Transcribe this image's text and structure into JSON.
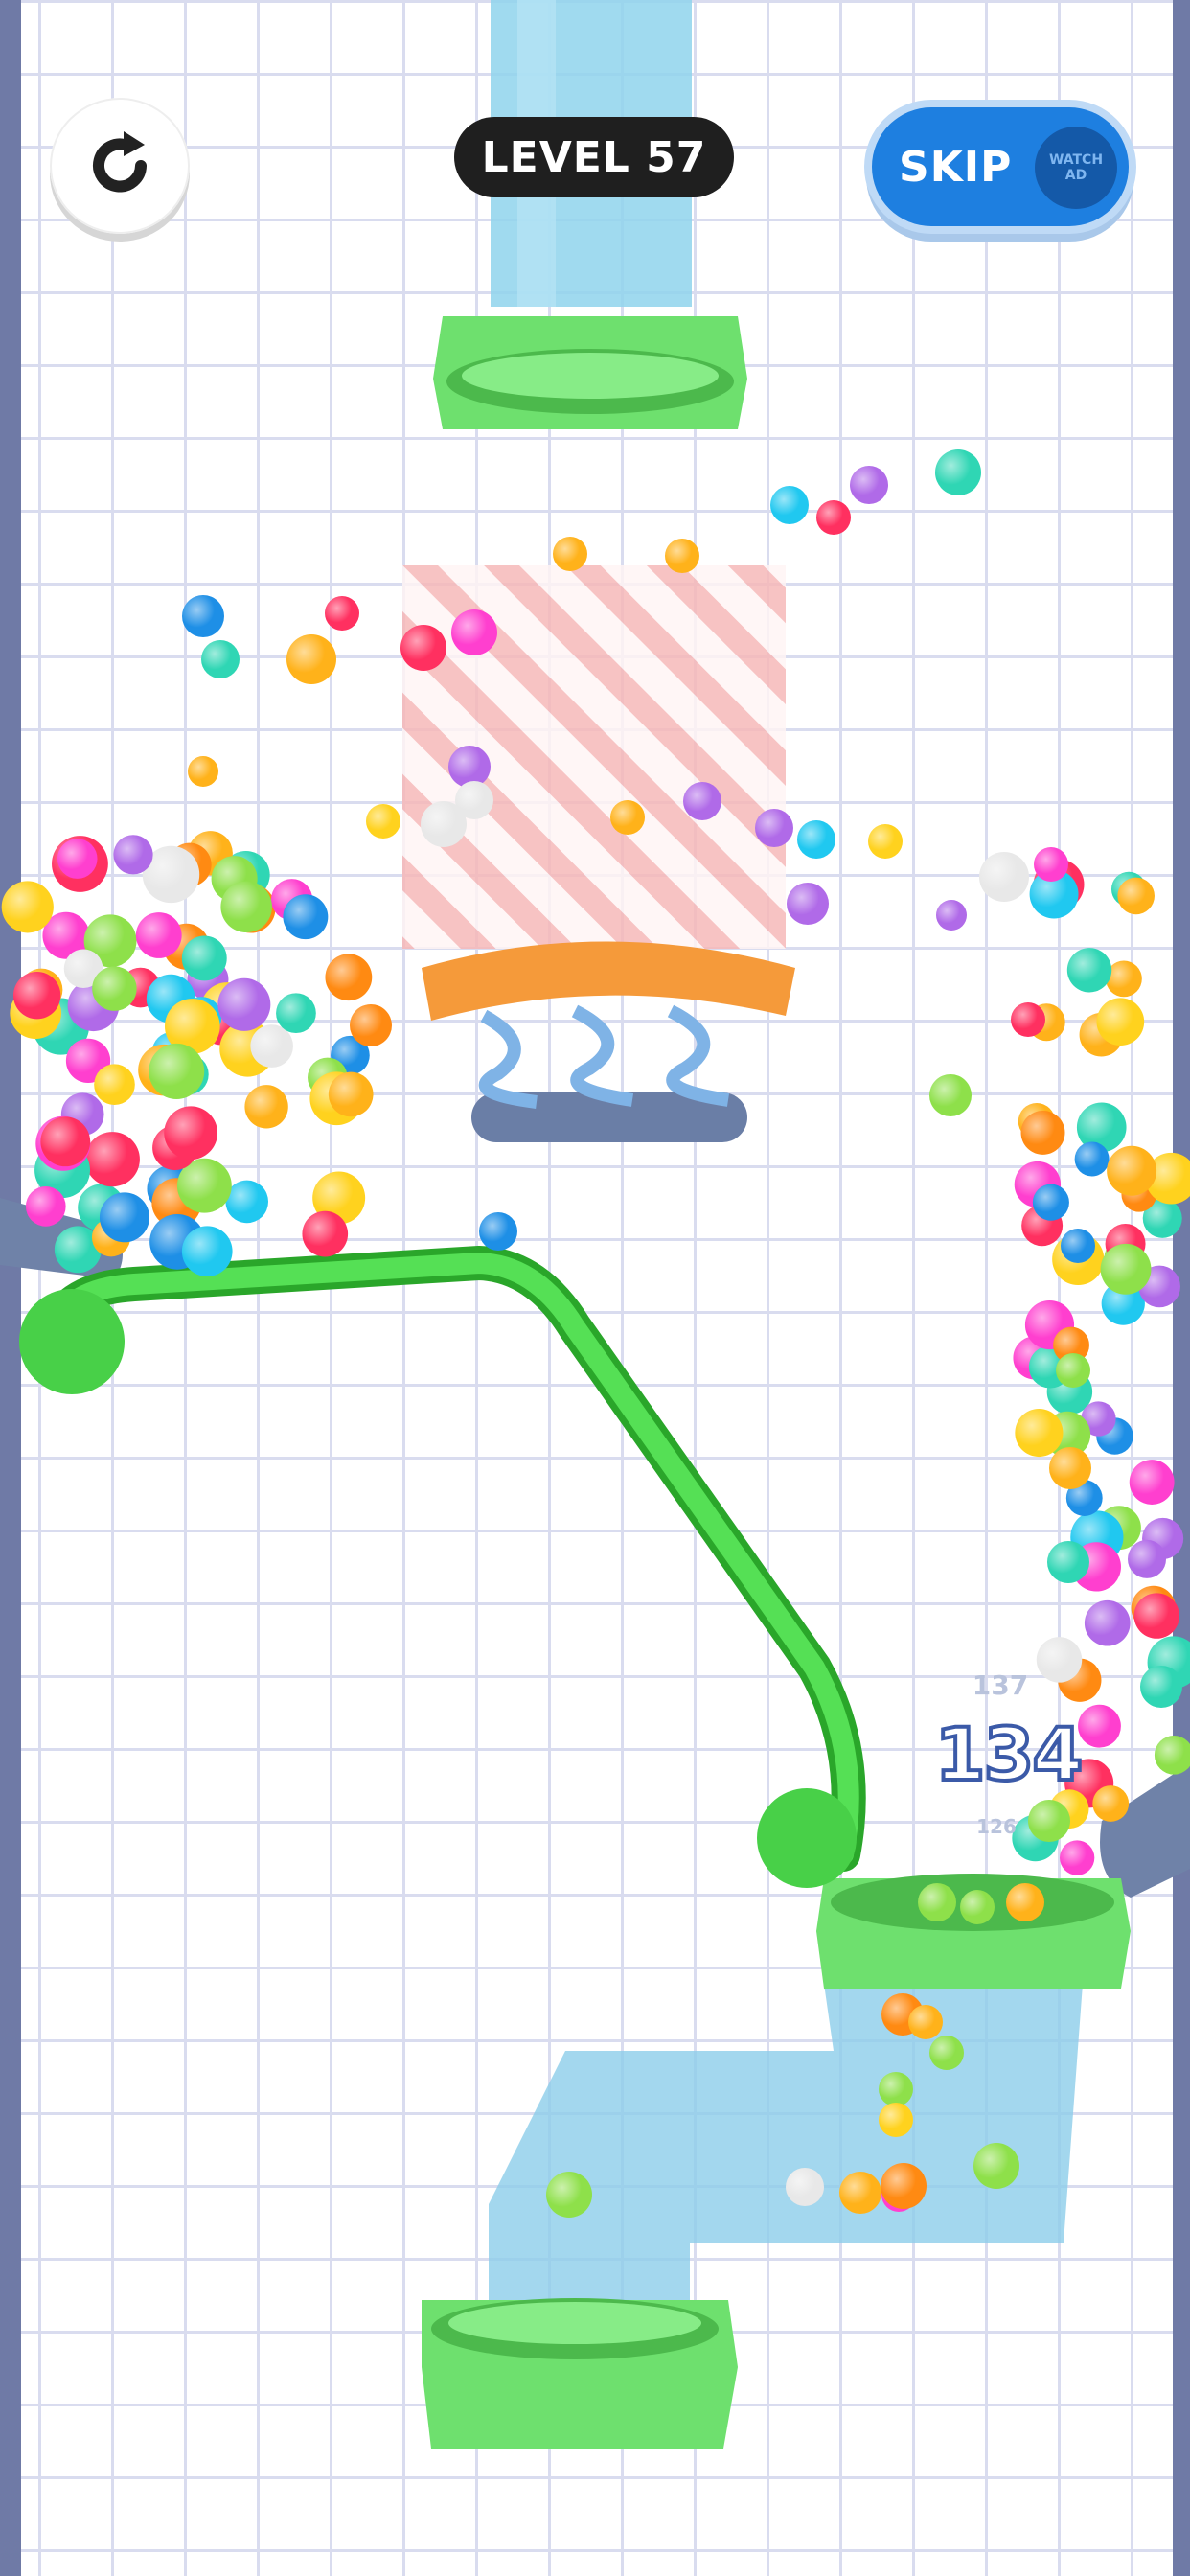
{
  "hud": {
    "level_label": "LEVEL 57",
    "skip_label": "SKIP",
    "watch_ad_line1": "WATCH",
    "watch_ad_line2": "AD"
  },
  "counter": {
    "current": "134",
    "previous": "137",
    "next": "126"
  },
  "icons": {
    "restart": "restart-icon"
  },
  "colors": {
    "pipe_green": "#6ee06e",
    "pipe_blue": "#7ccbe8",
    "drawn_line": "#3fcf3f",
    "skip_button": "#1e7fe0",
    "wall": "#6f7aa6",
    "hazard_stripe": "#f6b8b8",
    "spring_pad": "#f59a3a"
  }
}
